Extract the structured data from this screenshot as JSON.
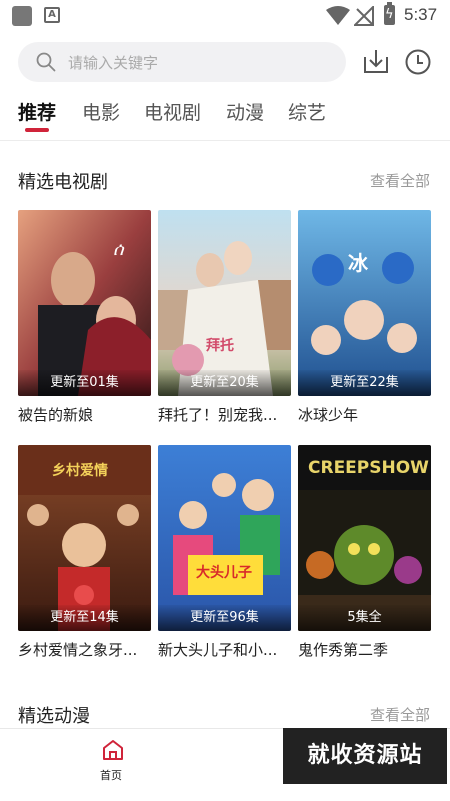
{
  "status_bar": {
    "time": "5:37",
    "a_label": "A"
  },
  "search": {
    "placeholder": "请输入关键字"
  },
  "tabs": [
    {
      "label": "推荐",
      "active": true
    },
    {
      "label": "电影"
    },
    {
      "label": "电视剧"
    },
    {
      "label": "动漫"
    },
    {
      "label": "综艺"
    }
  ],
  "sections": [
    {
      "title": "精选电视剧",
      "see_all": "查看全部",
      "items": [
        {
          "title": "被告的新娘",
          "badge": "更新至01集"
        },
        {
          "title": "拜托了！别宠我...",
          "badge": "更新至20集"
        },
        {
          "title": "冰球少年",
          "badge": "更新至22集"
        },
        {
          "title": "乡村爱情之象牙...",
          "badge": "更新至14集"
        },
        {
          "title": "新大头儿子和小...",
          "badge": "更新至96集"
        },
        {
          "title": "鬼作秀第二季",
          "badge": "5集全"
        }
      ]
    },
    {
      "title": "精选动漫",
      "see_all": "查看全部"
    }
  ],
  "bottom_nav": {
    "home_label": "首页"
  },
  "watermark": "就收资源站",
  "colors": {
    "accent": "#d0243a"
  }
}
